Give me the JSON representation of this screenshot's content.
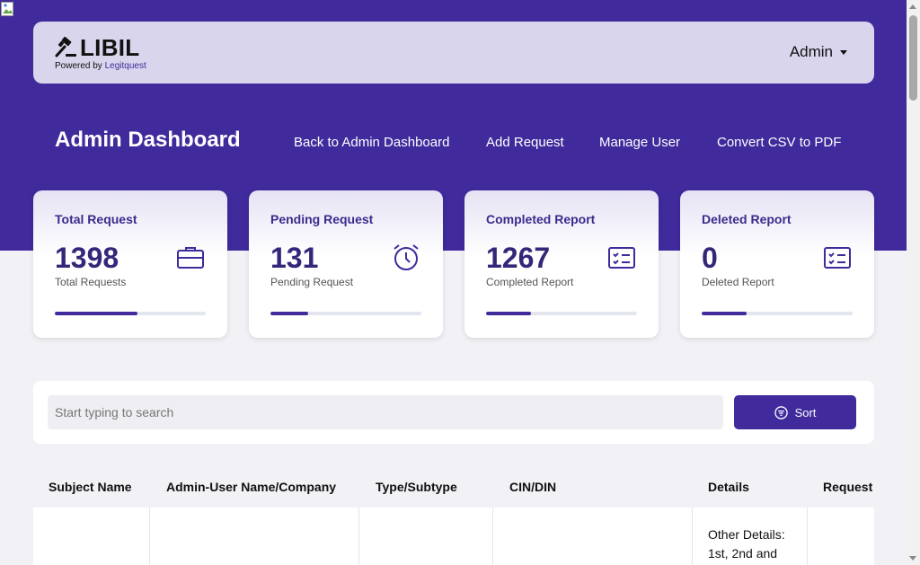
{
  "brand": {
    "name": "LIBIL",
    "powered_prefix": "Powered by ",
    "powered_brand": "Legitquest"
  },
  "user_menu": {
    "label": "Admin"
  },
  "header": {
    "title": "Admin Dashboard",
    "nav": [
      {
        "label": "Back to Admin Dashboard"
      },
      {
        "label": "Add Request"
      },
      {
        "label": "Manage User"
      },
      {
        "label": "Convert CSV to PDF"
      }
    ]
  },
  "stats": [
    {
      "title": "Total Request",
      "value": "1398",
      "sub": "Total Requests",
      "icon": "briefcase-icon",
      "progress": 0.55
    },
    {
      "title": "Pending Request",
      "value": "131",
      "sub": "Pending Request",
      "icon": "alarm-clock-icon",
      "progress": 0.25
    },
    {
      "title": "Completed Report",
      "value": "1267",
      "sub": "Completed Report",
      "icon": "checklist-icon",
      "progress": 0.3
    },
    {
      "title": "Deleted Report",
      "value": "0",
      "sub": "Deleted Report",
      "icon": "checklist-icon",
      "progress": 0.3
    }
  ],
  "search": {
    "placeholder": "Start typing to search",
    "value": "",
    "sort_label": "Sort"
  },
  "table": {
    "columns": [
      "Subject Name",
      "Admin-User Name/Company",
      "Type/Subtype",
      "CIN/DIN",
      "Details",
      "Request"
    ],
    "rows": [
      [
        "",
        "",
        "",
        "",
        "Other Details: 1st, 2nd and",
        ""
      ]
    ]
  },
  "colors": {
    "primary": "#402a9c",
    "navbar_bg": "#d9d5ec",
    "page_bg": "#f1f1f6",
    "card_title": "#3a2b8c"
  }
}
